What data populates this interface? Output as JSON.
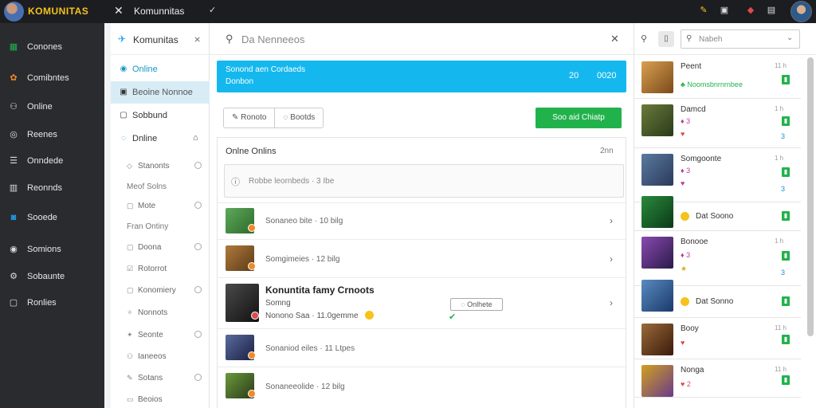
{
  "topbar": {
    "brand": "KOMUNITAS",
    "title": "Komunnitas",
    "icons": [
      "close-icon",
      "chevron-down-icon",
      "paint-icon",
      "window-icon",
      "bell-icon",
      "calendar-icon"
    ]
  },
  "leftnav": {
    "items": [
      {
        "label": "Conones",
        "icon": "grid-icon",
        "color": "#22b24c"
      },
      {
        "label": "Comibntes",
        "icon": "puzzle-icon",
        "color": "#f08a24"
      },
      {
        "label": "Online",
        "icon": "people-icon",
        "color": "#dddddd"
      },
      {
        "label": "Reenes",
        "icon": "circle-icon",
        "color": "#dddddd"
      },
      {
        "label": "Onndede",
        "icon": "list-icon",
        "color": "#dddddd"
      },
      {
        "label": "Reonnds",
        "icon": "table-icon",
        "color": "#dddddd"
      },
      {
        "label": "Sooede",
        "icon": "chat-icon",
        "color": "#1da1f2"
      },
      {
        "label": "Somions",
        "icon": "record-icon",
        "color": "#dddddd"
      },
      {
        "label": "Sobaunte",
        "icon": "gear-icon",
        "color": "#dddddd"
      },
      {
        "label": "Ronlies",
        "icon": "box-icon",
        "color": "#dddddd"
      }
    ]
  },
  "panel2": {
    "title": "Komunitas",
    "close": "⨯",
    "items": [
      {
        "label": "Online",
        "color": "#1598c7"
      },
      {
        "label": "Beoine Nonnoe",
        "color": "#333"
      },
      {
        "label": "Sobbund",
        "color": "#333"
      },
      {
        "label": "Dnline",
        "color": "#333"
      }
    ],
    "subs": [
      {
        "label": "Stanonts",
        "radio": true,
        "header": false
      },
      {
        "label": "Meof Solns",
        "radio": false,
        "header": true
      },
      {
        "label": "Mote",
        "radio": true,
        "header": false
      },
      {
        "label": "Fran Ontiny",
        "radio": false,
        "header": true
      },
      {
        "label": "Doona",
        "radio": true,
        "header": false
      },
      {
        "label": "Rotorrot",
        "radio": false,
        "header": false
      },
      {
        "label": "Konomiery",
        "radio": true,
        "header": false
      },
      {
        "label": "Nonnots",
        "radio": false,
        "header": false
      },
      {
        "label": "Seonte",
        "radio": true,
        "header": false
      },
      {
        "label": "Ianeeos",
        "radio": false,
        "header": false
      },
      {
        "label": "Sotans",
        "radio": true,
        "header": false
      },
      {
        "label": "Beoios",
        "radio": false,
        "header": false
      }
    ]
  },
  "main": {
    "search_value": "Da Nenneeos",
    "banner": {
      "line1": "Sonond aen Cordaeds",
      "line2": "Donbon",
      "num1": "20",
      "num2": "0020"
    },
    "segments": [
      "Ronoto",
      "Bootds"
    ],
    "action": "Soo aid Chiatp",
    "list_title": "Onlne Onlins",
    "list_count": "2nn",
    "list_search": "Robbe leornbeds · 3 Ibe",
    "rows": [
      {
        "text": "Sonaneo bite · 10 bilg",
        "featured": false,
        "av": "#3e8f3a"
      },
      {
        "text": "Somgimeies · 12 bilg",
        "featured": false,
        "av": "#8a5a2a"
      },
      {
        "title": "Konuntita famy Crnoots",
        "sub1": "Somng",
        "sub2": "Nonono Saa · 11.0gemme",
        "btn": "Onlhete",
        "featured": true,
        "av": "#2a2a2a"
      },
      {
        "text": "Sonaniod eiles · 11 Ltpes",
        "featured": false,
        "av": "#3a4a7a"
      },
      {
        "text": "Sonaneeolide · 12 bilg",
        "featured": false,
        "av": "#4a6a2a"
      }
    ]
  },
  "rightbar": {
    "search_placeholder": "Nabeh",
    "cards": [
      {
        "name": "Peent",
        "sub": "♣ Noomsbnrnrnbee",
        "time": "11 h",
        "num": "",
        "av": "#c9883a"
      },
      {
        "name": "Damcd",
        "sub": "♦ 3",
        "sub2": "♥",
        "time": "1 h",
        "num": "3",
        "av": "#4a5a2a"
      },
      {
        "name": "Somgoonte",
        "sub": "♦ 3",
        "sub2": "♥",
        "time": "1 h",
        "num": "3",
        "av": "#3a5a7a"
      },
      {
        "name": "Dat Soono",
        "sub": "",
        "time": "",
        "num": "",
        "av": "#1e7a2a"
      },
      {
        "name": "Bonooe",
        "sub": "♦ 3",
        "sub2": "★",
        "time": "1 h",
        "num": "3",
        "av": "#5a3a8a"
      },
      {
        "name": "Dat Sonno",
        "sub": "",
        "time": "",
        "num": "",
        "av": "#2a5a8a"
      },
      {
        "name": "Booy",
        "sub": "♥",
        "time": "11 h",
        "num": "",
        "av": "#6a3a1a"
      },
      {
        "name": "Nonga",
        "sub": "♥ 2",
        "time": "11 h",
        "num": "",
        "av": "#9a6a1a"
      }
    ]
  }
}
